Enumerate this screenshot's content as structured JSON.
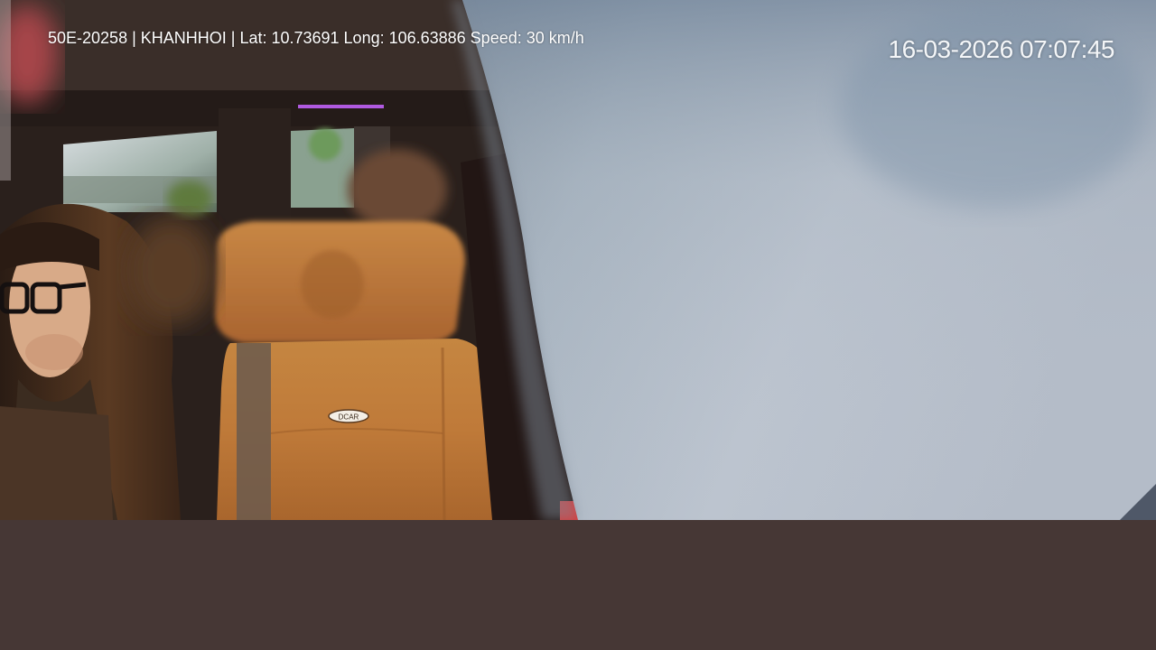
{
  "video": {
    "overlay_info": "50E-20258 | KHANHHOI | Lat: 10.73691 Long: 106.63886 Speed: 30 km/h",
    "timestamp": "16-03-2026 07:07:45",
    "seat_logo": "DCAR"
  },
  "colors": {
    "background_panel": "#463735",
    "overlay_text": "#ffffff",
    "seat_leather": "#c07a3a"
  }
}
